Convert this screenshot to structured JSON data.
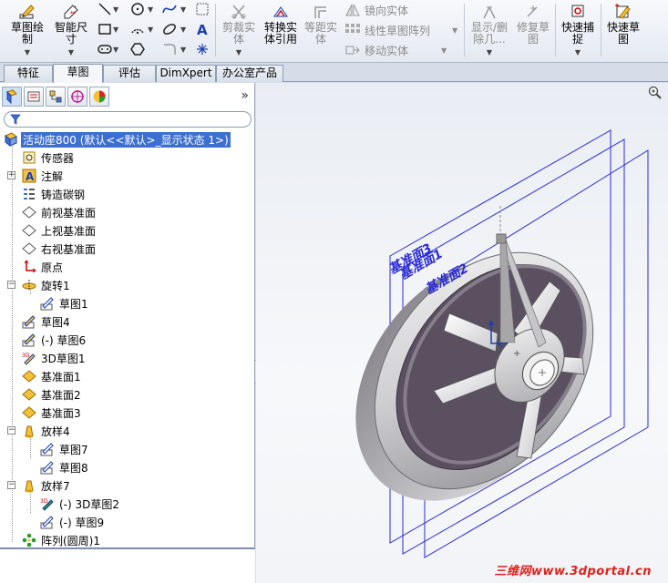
{
  "ribbon": {
    "sketch_draw": "草图绘\n制",
    "smart_dim": "智能尺\n寸",
    "trim": "剪裁实\n体",
    "convert": "转换实\n体引用",
    "offset": "等距实\n体",
    "mirror": "镜向实体",
    "linear_pattern": "线性草图阵列",
    "move": "移动实体",
    "show_delete": "显示/删\n除几...",
    "repair": "修复草\n图",
    "quick_snap": "快速捕\n捉",
    "quick_sketch": "快速草\n图"
  },
  "tabs": [
    "特征",
    "草图",
    "评估",
    "DimXpert",
    "办公室产品"
  ],
  "active_tab": "草图",
  "tree": {
    "root": "活动座800  (默认<<默认>_显示状态 1>)",
    "items": [
      "传感器",
      "注解",
      "铸造碳钢",
      "前视基准面",
      "上视基准面",
      "右视基准面",
      "原点",
      "旋转1",
      "草图1",
      "草图4",
      "(-) 草图6",
      "3D草图1",
      "基准面1",
      "基准面2",
      "基准面3",
      "放样4",
      "草图7",
      "草图8",
      "放样7",
      "(-) 3D草图2",
      "(-) 草图9",
      "阵列(圆周)1"
    ]
  },
  "viewport": {
    "plane_labels": [
      "基准面3",
      "基准面1",
      "基准面2"
    ],
    "watermark": "三维网www.3dportal.cn"
  },
  "colors": {
    "selection": "#3d6fd0",
    "plane": "#2a2ad8",
    "watermark": "#e0201a"
  }
}
